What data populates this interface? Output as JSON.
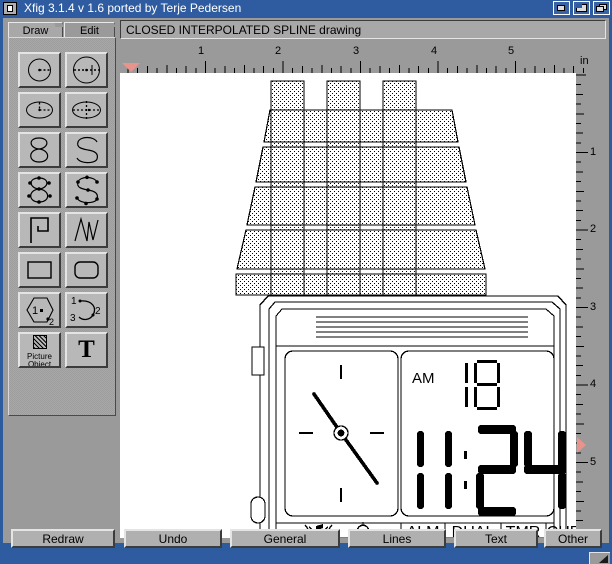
{
  "window": {
    "title": "Xfig 3.1.4 v 1.6 ported by Terje Pedersen",
    "sys_menu_icon": "system-menu-icon",
    "buttons": [
      {
        "name": "minimize-button",
        "icon": "minimize-icon"
      },
      {
        "name": "maximize-button",
        "icon": "maximize-icon"
      },
      {
        "name": "restore-button",
        "icon": "restore-icon"
      }
    ]
  },
  "tabs": [
    {
      "label": "Draw",
      "active": true
    },
    {
      "label": "Edit",
      "active": false
    }
  ],
  "command_line": {
    "value": "CLOSED INTERPOLATED SPLINE drawing"
  },
  "tools": [
    {
      "name": "circle-by-radius-tool",
      "icon": "circle-radius-icon"
    },
    {
      "name": "circle-by-diameter-tool",
      "icon": "circle-diameter-icon"
    },
    {
      "name": "ellipse-by-radius-tool",
      "icon": "ellipse-radius-icon"
    },
    {
      "name": "ellipse-by-diameter-tool",
      "icon": "ellipse-diameter-icon"
    },
    {
      "name": "closed-approx-spline-tool",
      "icon": "closed-spline-icon"
    },
    {
      "name": "open-approx-spline-tool",
      "icon": "open-spline-icon"
    },
    {
      "name": "closed-interpolated-spline-tool",
      "icon": "closed-interp-spline-icon"
    },
    {
      "name": "open-interpolated-spline-tool",
      "icon": "open-interp-spline-icon"
    },
    {
      "name": "polygon-tool",
      "icon": "polygon-icon"
    },
    {
      "name": "polyline-tool",
      "icon": "polyline-icon"
    },
    {
      "name": "box-tool",
      "icon": "box-icon"
    },
    {
      "name": "rounded-box-tool",
      "icon": "rounded-box-icon"
    },
    {
      "name": "regular-polygon-tool",
      "icon": "regular-polygon-icon"
    },
    {
      "name": "arc-tool",
      "icon": "arc-icon"
    },
    {
      "name": "picture-object-tool",
      "icon": "picture-object-icon",
      "label_line1": "Picture",
      "label_line2": "Object"
    },
    {
      "name": "text-tool",
      "icon": "text-icon",
      "label": "T"
    }
  ],
  "rulers": {
    "unit": "in",
    "horizontal_ticks": [
      "1",
      "2",
      "3",
      "4",
      "5"
    ],
    "vertical_ticks": [
      "1",
      "2",
      "3",
      "4",
      "5"
    ],
    "cursor_color": "#e8948c"
  },
  "drawing": {
    "title": "alarm clock radio line drawing",
    "lcd_time": "11:24",
    "lcd_meridiem": "AM",
    "lcd_secondary": "18",
    "face_buttons": [
      "ALM",
      "DUAL",
      "TMR",
      "CHR"
    ],
    "icons": [
      "music-note-icon",
      "bell-icon"
    ],
    "fill_pattern": "stipple-dots"
  },
  "bottom_buttons": [
    {
      "label": "Redraw",
      "name": "redraw-button"
    },
    {
      "label": "Undo",
      "name": "undo-button"
    },
    {
      "label": "General",
      "name": "general-button"
    },
    {
      "label": "Lines",
      "name": "lines-button"
    },
    {
      "label": "Text",
      "name": "text-button"
    },
    {
      "label": "Other",
      "name": "other-button"
    }
  ],
  "colors": {
    "titlebar": "#2f5ca0",
    "face": "#a8a8a8",
    "canvas": "#ffffff",
    "ruler_cursor": "#e8948c"
  }
}
